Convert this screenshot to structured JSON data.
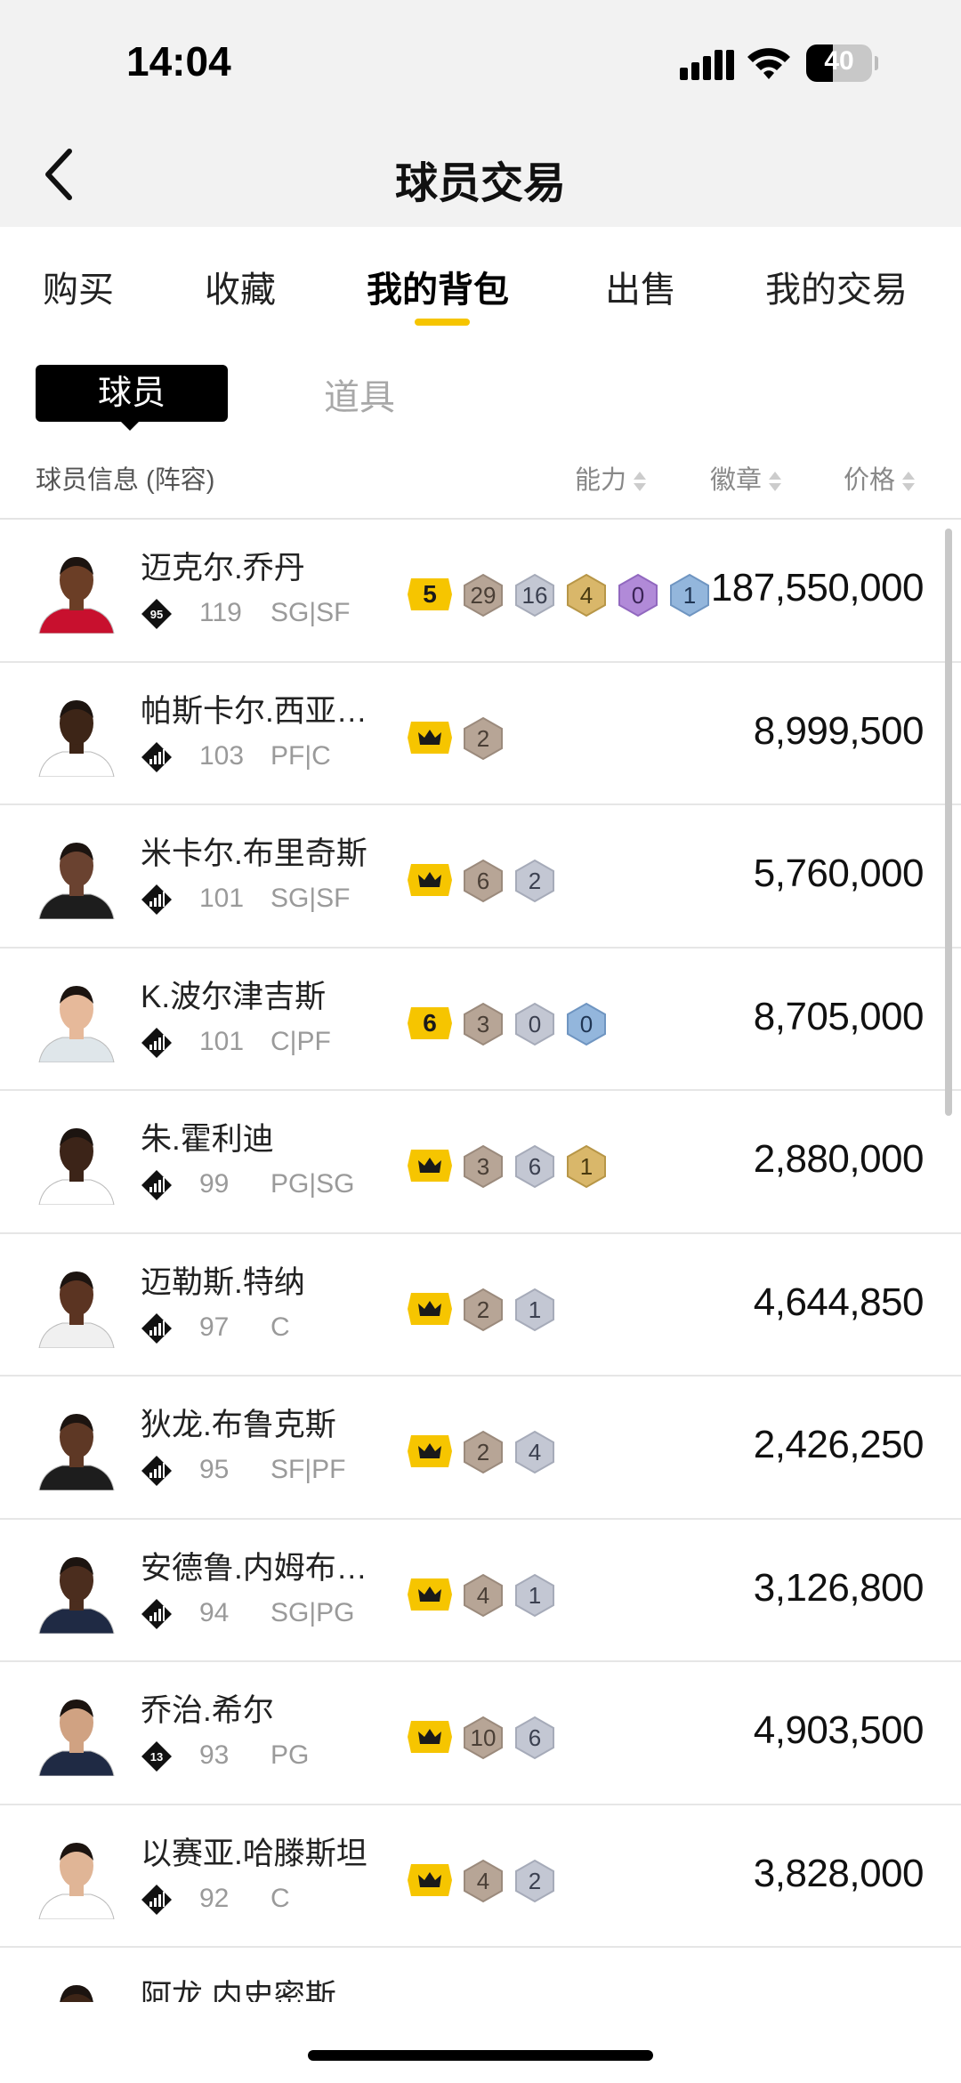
{
  "status_bar": {
    "time": "14:04",
    "battery_level": "40"
  },
  "header": {
    "title": "球员交易"
  },
  "tabs": [
    {
      "label": "购买",
      "active": false
    },
    {
      "label": "收藏",
      "active": false
    },
    {
      "label": "我的背包",
      "active": true
    },
    {
      "label": "出售",
      "active": false
    },
    {
      "label": "我的交易",
      "active": false
    }
  ],
  "segment": {
    "active": "球员",
    "inactive": "道具"
  },
  "columns": {
    "info": "球员信息 (阵容)",
    "ability": "能力",
    "badges": "徽章",
    "price": "价格"
  },
  "colors": {
    "accent": "#f6c500",
    "bronze": "#b7a596",
    "silver": "#c3c7d3",
    "gold": "#d9b76a",
    "purple": "#b18ad8",
    "blue": "#93b6dc"
  },
  "players": [
    {
      "name": "迈克尔.乔丹",
      "rank": "95",
      "rating": "119",
      "positions": "SG|SF",
      "level": "5",
      "badges": [
        {
          "tier": "bronze",
          "count": "29"
        },
        {
          "tier": "silver",
          "count": "16"
        },
        {
          "tier": "gold",
          "count": "4"
        },
        {
          "tier": "purple",
          "count": "0"
        },
        {
          "tier": "blue",
          "count": "1"
        }
      ],
      "price": "187,550,000"
    },
    {
      "name": "帕斯卡尔.西亚…",
      "rank": "",
      "rating": "103",
      "positions": "PF|C",
      "level": "crown",
      "badges": [
        {
          "tier": "bronze",
          "count": "2"
        }
      ],
      "price": "8,999,500"
    },
    {
      "name": "米卡尔.布里奇斯",
      "rank": "",
      "rating": "101",
      "positions": "SG|SF",
      "level": "crown",
      "badges": [
        {
          "tier": "bronze",
          "count": "6"
        },
        {
          "tier": "silver",
          "count": "2"
        }
      ],
      "price": "5,760,000"
    },
    {
      "name": "K.波尔津吉斯",
      "rank": "",
      "rating": "101",
      "positions": "C|PF",
      "level": "6",
      "badges": [
        {
          "tier": "bronze",
          "count": "3"
        },
        {
          "tier": "silver",
          "count": "0"
        },
        {
          "tier": "blue",
          "count": "0"
        }
      ],
      "price": "8,705,000"
    },
    {
      "name": "朱.霍利迪",
      "rank": "",
      "rating": "99",
      "positions": "PG|SG",
      "level": "crown",
      "badges": [
        {
          "tier": "bronze",
          "count": "3"
        },
        {
          "tier": "silver",
          "count": "6"
        },
        {
          "tier": "gold",
          "count": "1"
        }
      ],
      "price": "2,880,000"
    },
    {
      "name": "迈勒斯.特纳",
      "rank": "",
      "rating": "97",
      "positions": "C",
      "level": "crown",
      "badges": [
        {
          "tier": "bronze",
          "count": "2"
        },
        {
          "tier": "silver",
          "count": "1"
        }
      ],
      "price": "4,644,850"
    },
    {
      "name": "狄龙.布鲁克斯",
      "rank": "",
      "rating": "95",
      "positions": "SF|PF",
      "level": "crown",
      "badges": [
        {
          "tier": "bronze",
          "count": "2"
        },
        {
          "tier": "silver",
          "count": "4"
        }
      ],
      "price": "2,426,250"
    },
    {
      "name": "安德鲁.内姆布…",
      "rank": "",
      "rating": "94",
      "positions": "SG|PG",
      "level": "crown",
      "badges": [
        {
          "tier": "bronze",
          "count": "4"
        },
        {
          "tier": "silver",
          "count": "1"
        }
      ],
      "price": "3,126,800"
    },
    {
      "name": "乔治.希尔",
      "rank": "13",
      "rating": "93",
      "positions": "PG",
      "level": "crown",
      "badges": [
        {
          "tier": "bronze",
          "count": "10"
        },
        {
          "tier": "silver",
          "count": "6"
        }
      ],
      "price": "4,903,500"
    },
    {
      "name": "以赛亚.哈滕斯坦",
      "rank": "",
      "rating": "92",
      "positions": "C",
      "level": "crown",
      "badges": [
        {
          "tier": "bronze",
          "count": "4"
        },
        {
          "tier": "silver",
          "count": "2"
        }
      ],
      "price": "3,828,000"
    },
    {
      "name": "阿龙.内史密斯",
      "rank": "",
      "rating": "",
      "positions": "",
      "level": "crown",
      "badges": [],
      "price": ""
    }
  ]
}
